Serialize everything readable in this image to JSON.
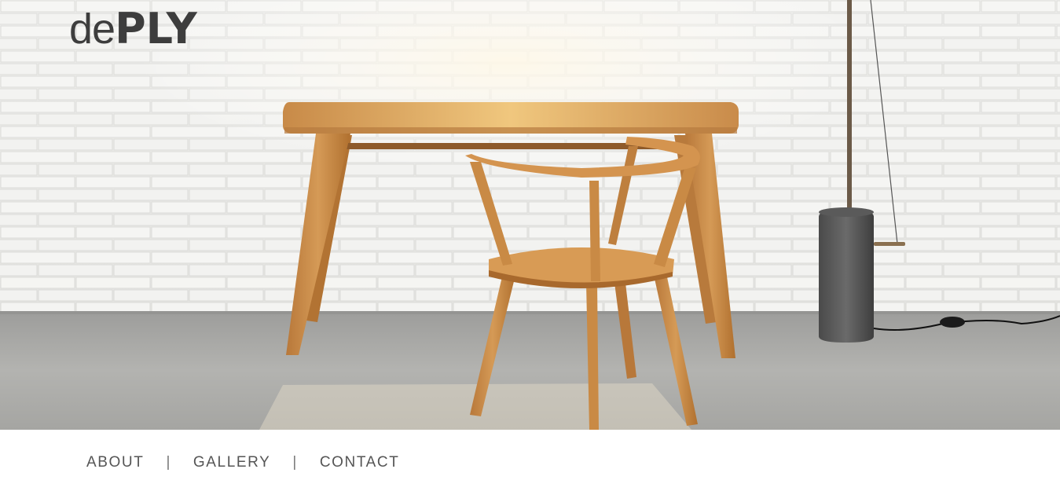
{
  "brand": {
    "logo_light": "de",
    "logo_bold": "PLY"
  },
  "hero": {
    "image_name": "table-chair-hero-photo"
  },
  "nav": {
    "items": [
      {
        "label": "ABOUT"
      },
      {
        "label": "GALLERY"
      },
      {
        "label": "CONTACT"
      }
    ],
    "separator": "|"
  },
  "colors": {
    "brick_wall": "#eeeeec",
    "concrete_floor": "#a9a9a7",
    "oak_wood": "#c98a45",
    "logo_text": "#3d3d3d",
    "nav_text": "#555555"
  }
}
